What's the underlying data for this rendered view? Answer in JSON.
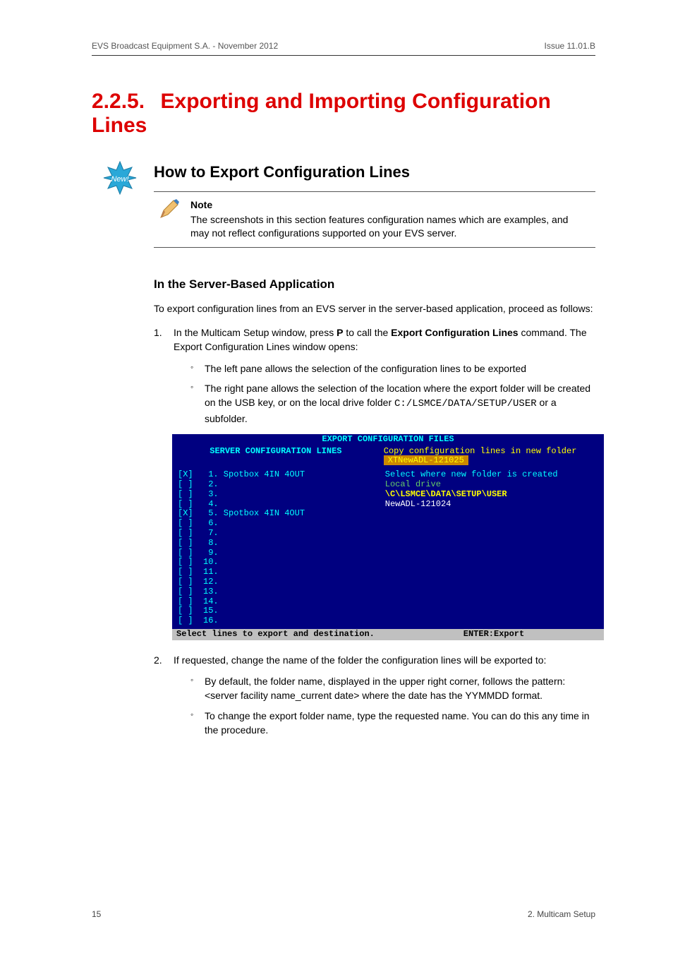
{
  "header": {
    "left": "EVS Broadcast Equipment S.A. - November 2012",
    "right": "Issue 11.01.B"
  },
  "section": {
    "number": "2.2.5.",
    "title": "Exporting and Importing Configuration Lines"
  },
  "badge": {
    "text": "New!"
  },
  "h2": "How to Export Configuration Lines",
  "note": {
    "title": "Note",
    "body": "The screenshots in this section features configuration names which are examples, and may not reflect configurations supported on your EVS server."
  },
  "h3": "In the Server-Based Application",
  "intro": "To export configuration lines from an EVS server in the server-based application, proceed as follows:",
  "step1": {
    "num": "1.",
    "pre": "In the Multicam Setup window, press ",
    "bold1": "P",
    "mid": " to call the ",
    "bold2": "Export Configuration Lines",
    "post": " command. The Export Configuration Lines window opens:",
    "bullet1": "The left pane allows the selection of the configuration lines to be exported",
    "bullet2_pre": "The right pane allows the selection of the location where the export folder will be created on the USB key, or on the local drive folder ",
    "bullet2_code": "C:/LSMCE/DATA/SETUP/USER",
    "bullet2_post": " or a subfolder."
  },
  "term": {
    "title": "EXPORT CONFIGURATION FILES",
    "left_header": "SERVER CONFIGURATION LINES",
    "right_header_pre": "Copy configuration lines in new folder",
    "right_header_box": "XTNewADL-121025",
    "lines": [
      "[X]   1. Spotbox 4IN 4OUT",
      "[ ]   2.",
      "[ ]   3.",
      "[ ]   4.",
      "[X]   5. Spotbox 4IN 4OUT",
      "[ ]   6.",
      "[ ]   7.",
      "[ ]   8.",
      "[ ]   9.",
      "[ ]  10.",
      "[ ]  11.",
      "[ ]  12.",
      "[ ]  13.",
      "[ ]  14.",
      "[ ]  15.",
      "[ ]  16."
    ],
    "right_l1": "Select where new folder is created",
    "right_l2": "Local drive",
    "right_l3": "\\C\\LSMCE\\DATA\\SETUP\\USER",
    "right_l4": "  NewADL-121024",
    "footer_left": "Select lines to export and destination.",
    "footer_right": "ENTER:Export"
  },
  "step2": {
    "num": "2.",
    "text": "If requested, change the name of the folder the configuration lines will be exported to:",
    "bullet1": "By default, the folder name, displayed in the upper right corner, follows the pattern: <server facility name_current date> where the date has the YYMMDD format.",
    "bullet2": "To change the export folder name, type the requested name. You can do this any time in the procedure."
  },
  "footer": {
    "left": "15",
    "right": "2. Multicam Setup"
  }
}
